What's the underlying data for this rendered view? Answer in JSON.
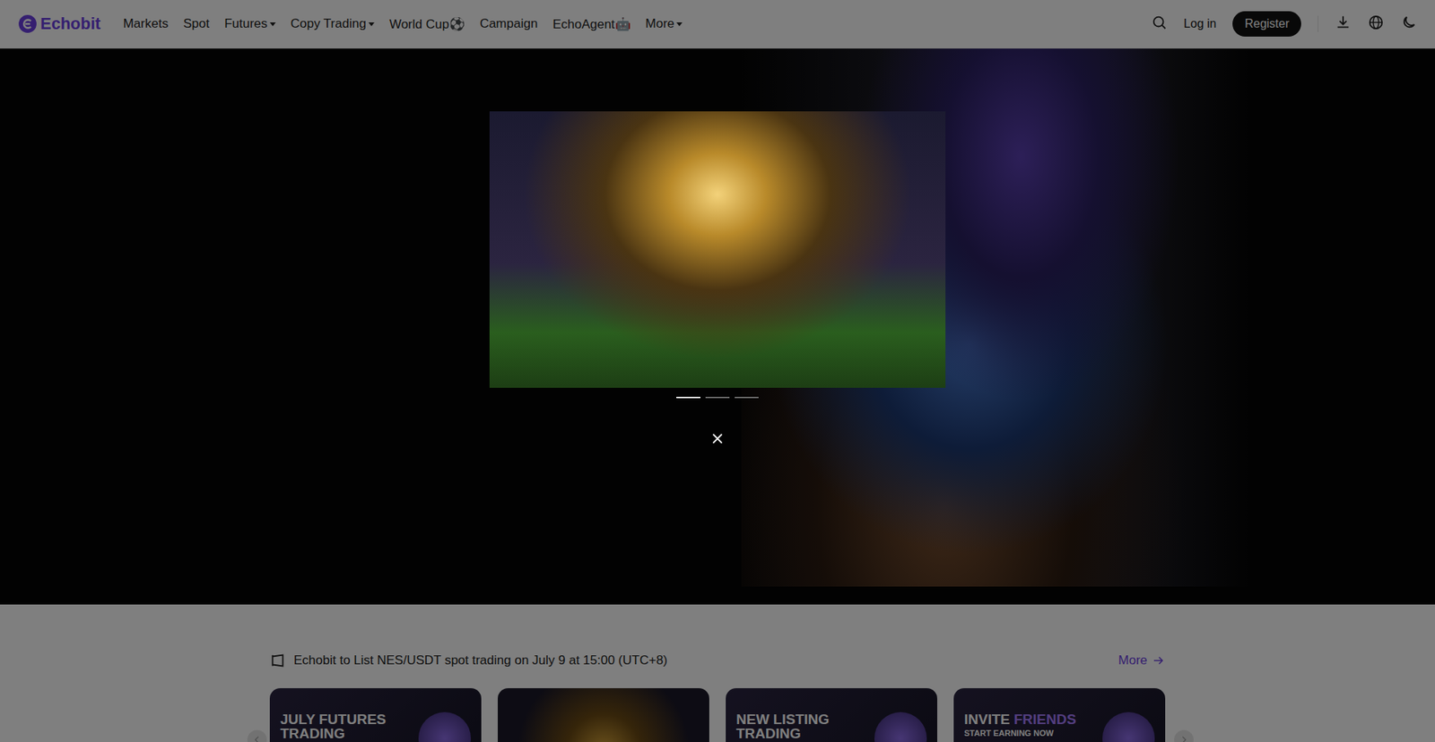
{
  "logo": "Echobit",
  "nav": [
    {
      "label": "Markets",
      "has_menu": false
    },
    {
      "label": "Spot",
      "has_menu": false
    },
    {
      "label": "Futures",
      "has_menu": true
    },
    {
      "label": "Copy Trading",
      "has_menu": true
    },
    {
      "label": "World Cup⚽",
      "has_menu": false
    },
    {
      "label": "Campaign",
      "has_menu": false
    },
    {
      "label": "EchoAgent🤖",
      "has_menu": false
    },
    {
      "label": "More",
      "has_menu": true
    }
  ],
  "header_actions": {
    "login": "Log in",
    "register": "Register"
  },
  "announcement": {
    "text": "Echobit to List NES/USDT spot trading on July 9 at 15:00 (UTC+8)",
    "more": "More"
  },
  "cards": [
    {
      "kind": "text",
      "title": "JULY FUTURES TRADING",
      "accent": "",
      "subtitle": ""
    },
    {
      "kind": "image"
    },
    {
      "kind": "text",
      "title": "NEW LISTING TRADING",
      "accent": "",
      "subtitle": ""
    },
    {
      "kind": "text",
      "title": "INVITE",
      "accent": "FRIENDS",
      "subtitle": "START EARNING NOW"
    }
  ],
  "modal": {
    "slides": [
      {
        "selected": true
      },
      {
        "selected": false
      },
      {
        "selected": false
      }
    ]
  }
}
